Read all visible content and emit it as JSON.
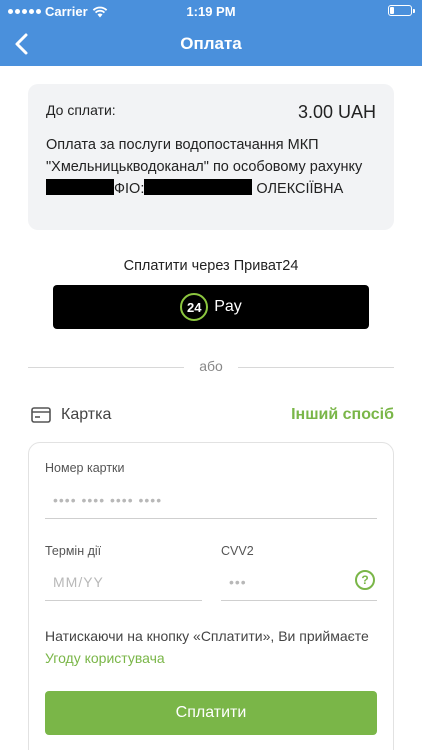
{
  "status_bar": {
    "carrier": "Carrier",
    "time": "1:19 PM"
  },
  "nav": {
    "title": "Оплата"
  },
  "summary": {
    "amount_label": "До сплати:",
    "amount_value": "3.00 UAH",
    "description_part1": "Оплата за послуги водопостачання МКП \"Хмельницькводоканал\" по особовому рахунку",
    "description_part2": "ФІО:",
    "description_part3": "ОЛЕКСІЇВНА"
  },
  "privat24": {
    "label": "Сплатити через Приват24",
    "badge": "24",
    "pay_label": "Pay"
  },
  "divider": {
    "text": "або"
  },
  "card_section": {
    "title": "Картка",
    "other_method": "Інший спосіб"
  },
  "form": {
    "card_number_label": "Номер картки",
    "card_number_placeholder": "•••• •••• •••• ••••",
    "expiry_label": "Термін дії",
    "expiry_placeholder": "ММ/YY",
    "cvv_label": "CVV2",
    "cvv_placeholder": "•••",
    "help_symbol": "?",
    "agreement_text": "Натискаючи на кнопку «Сплатити», Ви приймаєте",
    "agreement_link": "Угоду користувача",
    "submit_label": "Сплатити"
  },
  "colors": {
    "primary_blue": "#4a90dc",
    "accent_green": "#7ab648",
    "privat_green": "#8cc63f"
  }
}
